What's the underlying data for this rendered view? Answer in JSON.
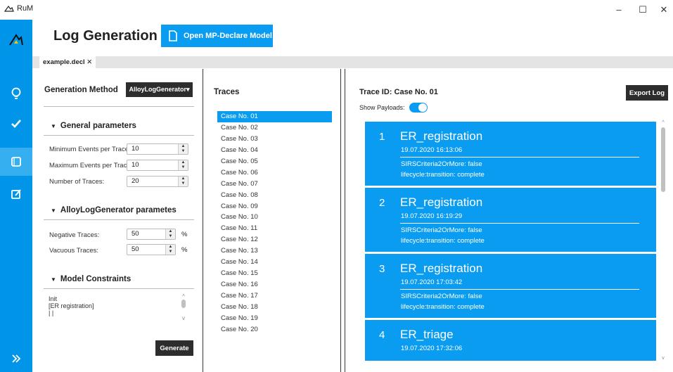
{
  "app": {
    "name": "RuM"
  },
  "window": {
    "minimize": "–",
    "maximize": "☐",
    "close": "✕"
  },
  "header": {
    "title": "Log Generation",
    "open_button": "Open MP-Declare Model"
  },
  "tabs": [
    {
      "label": "example.decl ✕"
    }
  ],
  "left": {
    "generation_method_label": "Generation Method",
    "generation_method_value": "AlloyLogGenerator▾",
    "general_title": "General parameters",
    "min_events_label": "Minimum Events per Trace:",
    "min_events_value": "10",
    "max_events_label": "Maximum Events per Trace:",
    "max_events_value": "10",
    "num_traces_label": "Number of Traces:",
    "num_traces_value": "20",
    "alloy_title": "AlloyLogGenerator parametes",
    "negative_label": "Negative Traces:",
    "negative_value": "50",
    "vacuous_label": "Vacuous Traces:",
    "vacuous_value": "50",
    "percent": "%",
    "constraints_title": "Model Constraints",
    "constraints": [
      "Init",
      "[ER registration]",
      "| |"
    ],
    "generate_button": "Generate"
  },
  "traces": {
    "title": "Traces",
    "items": [
      "Case No. 01",
      "Case No. 02",
      "Case No. 03",
      "Case No. 04",
      "Case No. 05",
      "Case No. 06",
      "Case No. 07",
      "Case No. 08",
      "Case No. 09",
      "Case No. 10",
      "Case No. 11",
      "Case No. 12",
      "Case No. 13",
      "Case No. 14",
      "Case No. 15",
      "Case No. 16",
      "Case No. 17",
      "Case No. 18",
      "Case No. 19",
      "Case No. 20"
    ],
    "selected_index": 0
  },
  "detail": {
    "trace_id": "Trace ID: Case No. 01",
    "export_button": "Export Log",
    "show_payloads_label": "Show Payloads:",
    "show_payloads": true,
    "events": [
      {
        "num": "1",
        "name": "ER_registration",
        "timestamp": "19.07.2020 16:13:06",
        "payload1": "SIRSCriteria2OrMore: false",
        "payload2": "lifecycle:transition: complete"
      },
      {
        "num": "2",
        "name": "ER_registration",
        "timestamp": "19.07.2020 16:19:29",
        "payload1": "SIRSCriteria2OrMore: false",
        "payload2": "lifecycle:transition: complete"
      },
      {
        "num": "3",
        "name": "ER_registration",
        "timestamp": "19.07.2020 17:03:42",
        "payload1": "SIRSCriteria2OrMore: false",
        "payload2": "lifecycle:transition: complete"
      },
      {
        "num": "4",
        "name": "ER_triage",
        "timestamp": "19.07.2020 17:32:06",
        "payload1": "",
        "payload2": ""
      }
    ]
  },
  "colors": {
    "accent": "#0a9cf0",
    "rail": "#0095e8",
    "dark_button": "#2d2d2d"
  }
}
